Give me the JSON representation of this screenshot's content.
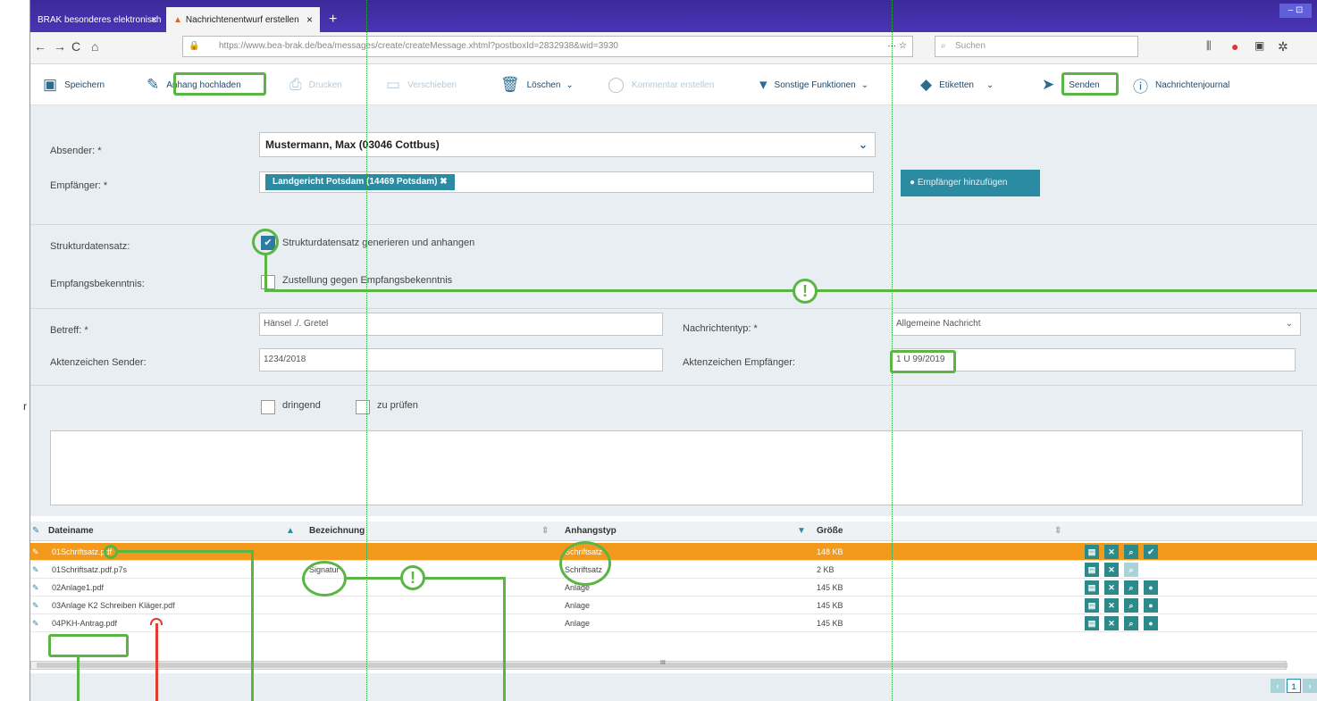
{
  "browser": {
    "tabs": [
      {
        "label": "BRAK besonderes elektronisch",
        "close": "×"
      },
      {
        "label": "Nachrichtenentwurf erstellen",
        "close": "×"
      }
    ],
    "new_tab": "+",
    "window_controls": "– ⊡",
    "url_host": "https://www.bea-brak.de",
    "url_path": "/bea/messages/create/createMessage.xhtml?postboxId=2832938&wid=3930",
    "url_more": "···",
    "search_placeholder": "Suchen"
  },
  "toolbar": {
    "save": "Speichern",
    "upload": "Anhang hochladen",
    "print": "Drucken",
    "move": "Verschieben",
    "delete": "Löschen",
    "comment": "Kommentar erstellen",
    "other": "Sonstige Funktionen",
    "labels": "Etiketten",
    "send": "Senden",
    "journal": "Nachrichtenjournal"
  },
  "form": {
    "sender_label": "Absender: *",
    "sender_value": "Mustermann, Max (03046 Cottbus)",
    "recipient_label": "Empfänger: *",
    "recipient_tag": "Landgericht Potsdam (14469 Potsdam)",
    "add_recipient": "Empfänger hinzufügen",
    "struct_label": "Strukturdatensatz:",
    "struct_option": "Strukturdatensatz generieren und anhangen",
    "ack_label": "Empfangsbekenntnis:",
    "ack_option": "Zustellung gegen Empfangsbekenntnis",
    "subject_label": "Betreff: *",
    "subject_value": "Hänsel ./. Gretel",
    "msgtype_label": "Nachrichtentyp: *",
    "msgtype_value": "Allgemeine Nachricht",
    "ref_sender_label": "Aktenzeichen Sender:",
    "ref_sender_value": "1234/2018",
    "ref_recipient_label": "Aktenzeichen Empfänger:",
    "ref_recipient_value": "1 U 99/2019",
    "urgent": "dringend",
    "check": "zu prüfen"
  },
  "table": {
    "headers": [
      "Dateiname",
      "Bezeichnung",
      "Anhangstyp",
      "Größe"
    ],
    "rows": [
      {
        "name": "01Schriftsatz.pdf",
        "desc": "",
        "type": "Schriftsatz",
        "size": "148 KB"
      },
      {
        "name": "01Schriftsatz.pdf.p7s",
        "desc": "Signatur",
        "type": "Schriftsatz",
        "size": "2 KB"
      },
      {
        "name": "02Anlage1.pdf",
        "desc": "",
        "type": "Anlage",
        "size": "145 KB"
      },
      {
        "name": "03Anlage K2 Schreiben Kläger.pdf",
        "desc": "",
        "type": "Anlage",
        "size": "145 KB"
      },
      {
        "name": "04PKH-Antrag.pdf",
        "desc": "",
        "type": "Anlage",
        "size": "145 KB"
      }
    ],
    "scroll_grip": "III",
    "page": "1"
  },
  "annotation": {
    "mark": "!",
    "left_letter": "r"
  }
}
